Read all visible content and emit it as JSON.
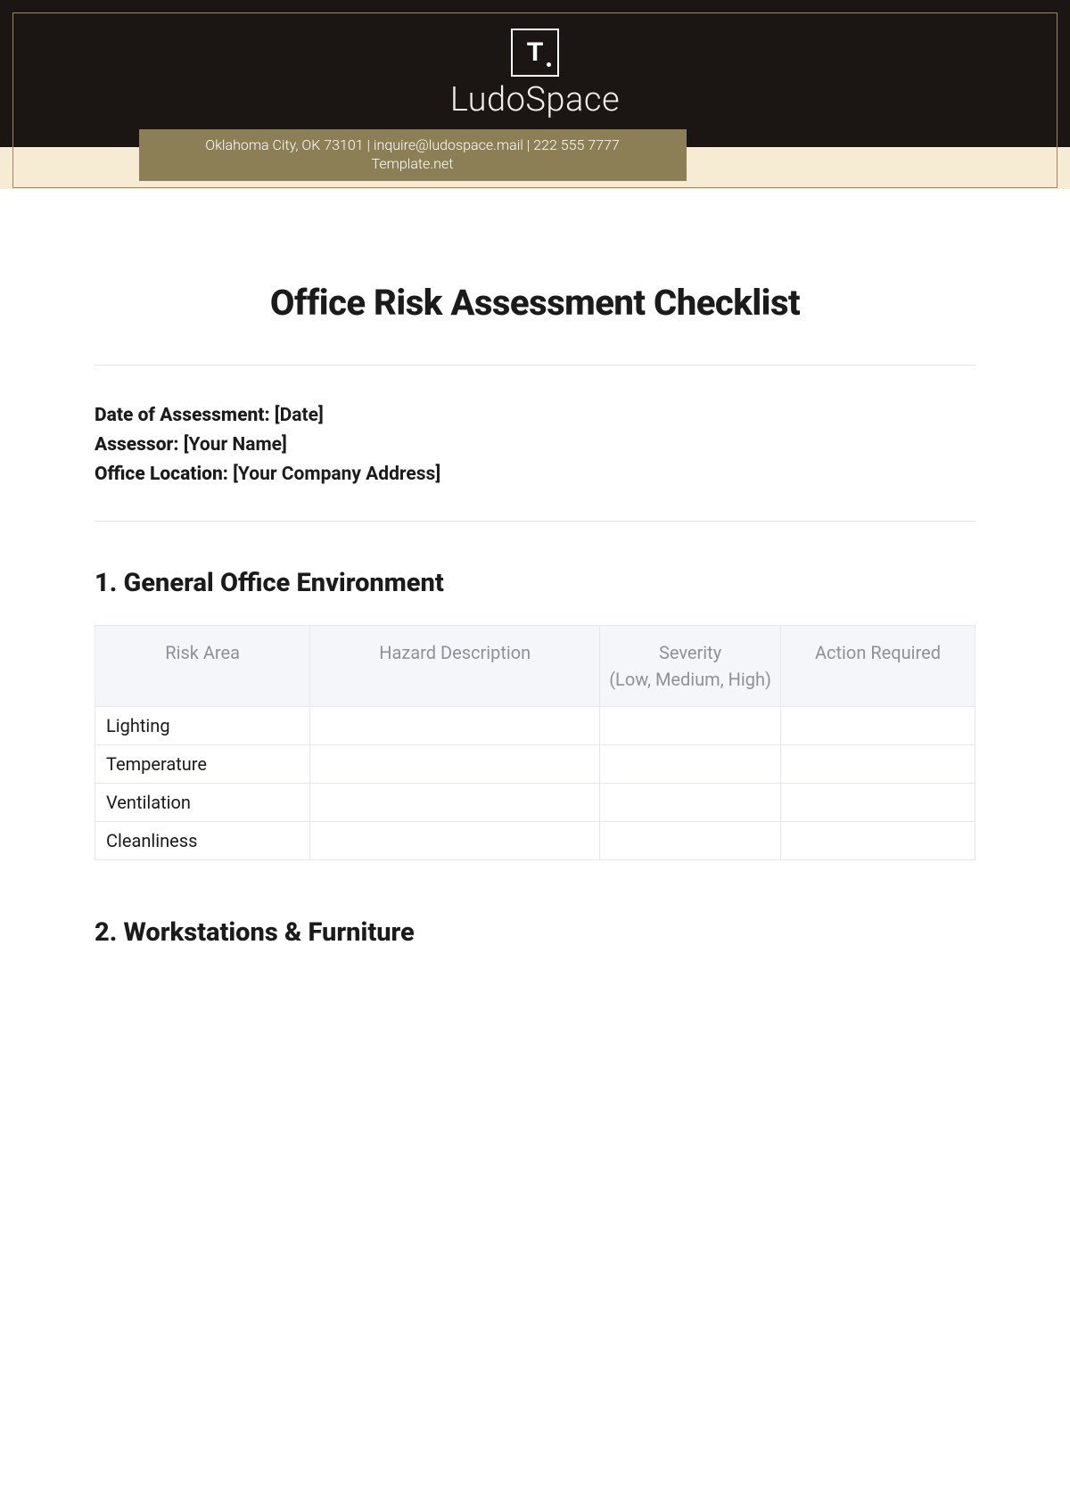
{
  "header": {
    "logo_letter": "T.",
    "company_name": "LudoSpace",
    "contact_line": "Oklahoma City, OK 73101 | inquire@ludospace.mail | 222 555 7777",
    "template_line": "Template.net"
  },
  "title": "Office Risk Assessment Checklist",
  "meta": {
    "date_label": "Date of Assessment:",
    "date_value": "[Date]",
    "assessor_label": "Assessor:",
    "assessor_value": "[Your Name]",
    "location_label": "Office Location:",
    "location_value": "[Your Company Address]"
  },
  "sections": [
    {
      "heading": "1. General Office Environment",
      "columns": [
        "Risk Area",
        "Hazard Description",
        "Severity",
        "Action Required"
      ],
      "severity_sub": "(Low, Medium, High)",
      "rows": [
        {
          "risk_area": "Lighting",
          "hazard": "",
          "severity": "",
          "action": ""
        },
        {
          "risk_area": "Temperature",
          "hazard": "",
          "severity": "",
          "action": ""
        },
        {
          "risk_area": "Ventilation",
          "hazard": "",
          "severity": "",
          "action": ""
        },
        {
          "risk_area": "Cleanliness",
          "hazard": "",
          "severity": "",
          "action": ""
        }
      ]
    },
    {
      "heading": "2. Workstations & Furniture"
    }
  ]
}
